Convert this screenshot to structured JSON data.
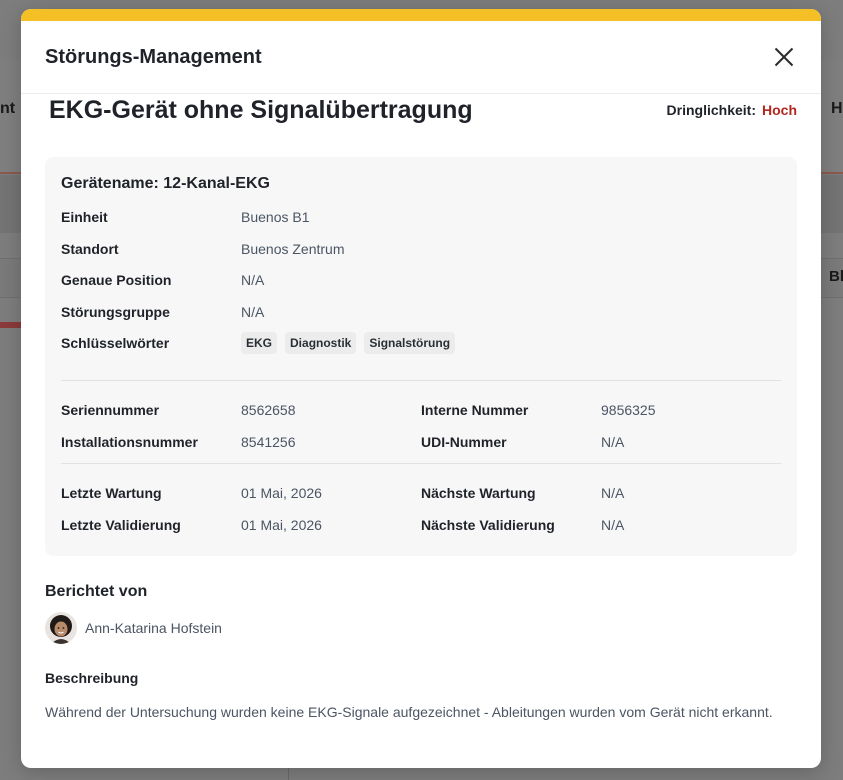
{
  "background": {
    "left_text": "nt",
    "right_text": "H",
    "right_col_text": "Bl"
  },
  "modal": {
    "accent_color": "#f5c026",
    "title": "Störungs-Management",
    "close_icon": "close-icon"
  },
  "incident": {
    "title": "EKG-Gerät ohne Signalübertragung",
    "urgency_label": "Dringlichkeit:",
    "urgency_value": "Hoch",
    "urgency_color": "#b3261e"
  },
  "device": {
    "card_title": "Gerätename: 12-Kanal-EKG",
    "fields": [
      {
        "label": "Einheit",
        "value": "Buenos B1"
      },
      {
        "label": "Standort",
        "value": "Buenos Zentrum"
      },
      {
        "label": "Genaue Position",
        "value": "N/A"
      },
      {
        "label": "Störungsgruppe",
        "value": "N/A"
      }
    ],
    "keywords_label": "Schlüsselwörter",
    "keywords": [
      "EKG",
      "Diagnostik",
      "Signalstörung"
    ],
    "ids": {
      "serial_label": "Seriennummer",
      "serial_value": "8562658",
      "internal_label": "Interne Nummer",
      "internal_value": "9856325",
      "install_label": "Installationsnummer",
      "install_value": "8541256",
      "udi_label": "UDI-Nummer",
      "udi_value": "N/A"
    },
    "maintenance": {
      "last_maint_label": "Letzte Wartung",
      "last_maint_value": "01 Mai, 2026",
      "next_maint_label": "Nächste Wartung",
      "next_maint_value": "N/A",
      "last_valid_label": "Letzte Validierung",
      "last_valid_value": "01 Mai, 2026",
      "next_valid_label": "Nächste Validierung",
      "next_valid_value": "N/A"
    }
  },
  "reporter": {
    "heading": "Berichtet von",
    "name": "Ann-Katarina Hofstein"
  },
  "description": {
    "heading": "Beschreibung",
    "text": "Während der Untersuchung wurden keine EKG-Signale aufgezeichnet - Ableitungen wurden vom Gerät nicht erkannt."
  }
}
